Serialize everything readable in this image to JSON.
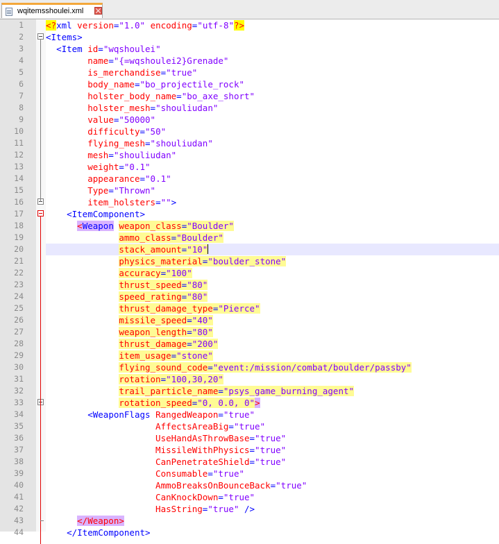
{
  "tab": {
    "title": "wqitemsshoulei.xml"
  },
  "lines": [
    {
      "n": "1",
      "html": "<span class=\"pi\">&lt;?</span><span class=\"tag\">xml</span> <span class=\"attr\">version</span>=<span class=\"str\">\"1.0\"</span> <span class=\"attr\">encoding</span>=<span class=\"str\">\"utf-8\"</span><span class=\"pi\">?&gt;</span>"
    },
    {
      "n": "2",
      "html": "<span class=\"tag\">&lt;Items&gt;</span>"
    },
    {
      "n": "3",
      "html": "  <span class=\"tag\">&lt;Item</span> <span class=\"attr\">id</span>=<span class=\"str\">\"wqshoulei\"</span>"
    },
    {
      "n": "4",
      "html": "        <span class=\"attr\">name</span>=<span class=\"str\">\"{=wqshoulei2}Grenade\"</span>"
    },
    {
      "n": "5",
      "html": "        <span class=\"attr\">is_merchandise</span>=<span class=\"str\">\"true\"</span>"
    },
    {
      "n": "6",
      "html": "        <span class=\"attr\">body_name</span>=<span class=\"str\">\"bo_projectile_rock\"</span>"
    },
    {
      "n": "7",
      "html": "        <span class=\"attr\">holster_body_name</span>=<span class=\"str\">\"bo_axe_short\"</span>"
    },
    {
      "n": "8",
      "html": "        <span class=\"attr\">holster_mesh</span>=<span class=\"str\">\"shouliudan\"</span>"
    },
    {
      "n": "9",
      "html": "        <span class=\"attr\">value</span>=<span class=\"str\">\"50000\"</span>"
    },
    {
      "n": "10",
      "html": "        <span class=\"attr\">difficulty</span>=<span class=\"str\">\"50\"</span>"
    },
    {
      "n": "11",
      "html": "        <span class=\"attr\">flying_mesh</span>=<span class=\"str\">\"shouliudan\"</span>"
    },
    {
      "n": "12",
      "html": "        <span class=\"attr\">mesh</span>=<span class=\"str\">\"shouliudan\"</span>"
    },
    {
      "n": "13",
      "html": "        <span class=\"attr\">weight</span>=<span class=\"str\">\"0.1\"</span>"
    },
    {
      "n": "14",
      "html": "        <span class=\"attr\">appearance</span>=<span class=\"str\">\"0.1\"</span>"
    },
    {
      "n": "15",
      "html": "        <span class=\"attr\">Type</span>=<span class=\"str\">\"Thrown\"</span>"
    },
    {
      "n": "16",
      "html": "        <span class=\"attr\">item_holsters</span>=<span class=\"str\">\"\"</span><span class=\"tag\">&gt;</span>"
    },
    {
      "n": "17",
      "html": "    <span class=\"tag\">&lt;ItemComponent&gt;</span>"
    },
    {
      "n": "18",
      "html": "      <span class=\"mtag\">&lt;</span><span class=\"mtag2\" style=\"color:#0000ff\">Weapon</span> <span class=\"hl\"><span class=\"attr\">weapon_class</span>=<span class=\"str\">\"Boulder\"</span></span>"
    },
    {
      "n": "19",
      "html": "              <span class=\"hl\"><span class=\"attr\">ammo_class</span>=<span class=\"str\">\"Boulder\"</span></span>"
    },
    {
      "n": "20",
      "html": "              <span class=\"hl\"><span class=\"attr\">stack_amount</span>=<span class=\"str\">\"10\"</span></span><span class=\"caret\"></span>",
      "current": true
    },
    {
      "n": "21",
      "html": "              <span class=\"hl\"><span class=\"attr\">physics_material</span>=<span class=\"str\">\"boulder_stone\"</span></span>"
    },
    {
      "n": "22",
      "html": "              <span class=\"hl\"><span class=\"attr\">accuracy</span>=<span class=\"str\">\"100\"</span></span>"
    },
    {
      "n": "23",
      "html": "              <span class=\"hl\"><span class=\"attr\">thrust_speed</span>=<span class=\"str\">\"80\"</span></span>"
    },
    {
      "n": "24",
      "html": "              <span class=\"hl\"><span class=\"attr\">speed_rating</span>=<span class=\"str\">\"80\"</span></span>"
    },
    {
      "n": "25",
      "html": "              <span class=\"hl\"><span class=\"attr\">thrust_damage_type</span>=<span class=\"str\">\"Pierce\"</span></span>"
    },
    {
      "n": "26",
      "html": "              <span class=\"hl\"><span class=\"attr\">missile_speed</span>=<span class=\"str\">\"40\"</span></span>"
    },
    {
      "n": "27",
      "html": "              <span class=\"hl\"><span class=\"attr\">weapon_length</span>=<span class=\"str\">\"80\"</span></span>"
    },
    {
      "n": "28",
      "html": "              <span class=\"hl\"><span class=\"attr\">thrust_damage</span>=<span class=\"str\">\"200\"</span></span>"
    },
    {
      "n": "29",
      "html": "              <span class=\"hl\"><span class=\"attr\">item_usage</span>=<span class=\"str\">\"stone\"</span></span>"
    },
    {
      "n": "30",
      "html": "              <span class=\"hl\"><span class=\"attr\">flying_sound_code</span>=<span class=\"str\">\"event:/mission/combat/boulder/passby\"</span></span>"
    },
    {
      "n": "31",
      "html": "              <span class=\"hl\"><span class=\"attr\">rotation</span>=<span class=\"str\">\"100,30,20\"</span></span>"
    },
    {
      "n": "32",
      "html": "              <span class=\"hl\"><span class=\"attr\">trail_particle_name</span>=<span class=\"str\">\"psys_game_burning_agent\"</span></span>"
    },
    {
      "n": "33",
      "html": "              <span class=\"hl\"><span class=\"attr\">rotation_speed</span>=<span class=\"str\">\"0, 0.0, 0\"</span></span><span class=\"mtag\">&gt;</span>"
    },
    {
      "n": "34",
      "html": "        <span class=\"tag\">&lt;WeaponFlags</span> <span class=\"attr\">RangedWeapon</span>=<span class=\"str\">\"true\"</span>"
    },
    {
      "n": "35",
      "html": "                     <span class=\"attr\">AffectsAreaBig</span>=<span class=\"str\">\"true\"</span>"
    },
    {
      "n": "36",
      "html": "                     <span class=\"attr\">UseHandAsThrowBase</span>=<span class=\"str\">\"true\"</span>"
    },
    {
      "n": "37",
      "html": "                     <span class=\"attr\">MissileWithPhysics</span>=<span class=\"str\">\"true\"</span>"
    },
    {
      "n": "38",
      "html": "                     <span class=\"attr\">CanPenetrateShield</span>=<span class=\"str\">\"true\"</span>"
    },
    {
      "n": "39",
      "html": "                     <span class=\"attr\">Consumable</span>=<span class=\"str\">\"true\"</span>"
    },
    {
      "n": "40",
      "html": "                     <span class=\"attr\">AmmoBreaksOnBounceBack</span>=<span class=\"str\">\"true\"</span>"
    },
    {
      "n": "41",
      "html": "                     <span class=\"attr\">CanKnockDown</span>=<span class=\"str\">\"true\"</span>"
    },
    {
      "n": "42",
      "html": "                     <span class=\"attr\">HasString</span>=<span class=\"str\">\"true\"</span> <span class=\"tag\">/&gt;</span>"
    },
    {
      "n": "43",
      "html": "      <span class=\"mtag\">&lt;/Weapon&gt;</span>"
    },
    {
      "n": "44",
      "html": "    <span class=\"tag\">&lt;/ItemComponent&gt;</span>"
    }
  ]
}
